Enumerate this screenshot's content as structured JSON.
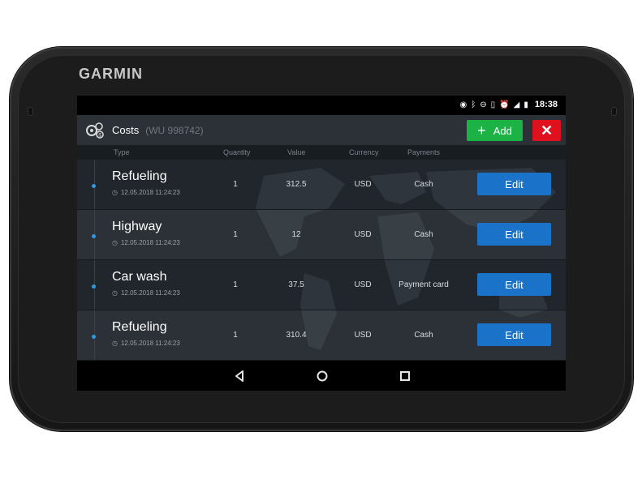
{
  "device": {
    "brand": "GARMIN"
  },
  "status_bar": {
    "time": "18:38"
  },
  "header": {
    "title": "Costs",
    "subtitle": "(WU 998742)",
    "add_label": "Add",
    "close_symbol": "✕",
    "colors": {
      "add": "#1db245",
      "close": "#e0111f"
    }
  },
  "table": {
    "columns": [
      "Type",
      "Quantity",
      "Value",
      "Currency",
      "Payments"
    ],
    "rows": [
      {
        "type": "Refueling",
        "date": "12.05.2018 11:24:23",
        "quantity": "1",
        "value": "312.5",
        "currency": "USD",
        "payment": "Cash",
        "action": "Edit"
      },
      {
        "type": "Highway",
        "date": "12.05.2018 11:24:23",
        "quantity": "1",
        "value": "12",
        "currency": "USD",
        "payment": "Cash",
        "action": "Edit"
      },
      {
        "type": "Car wash",
        "date": "12.05.2018 11:24:23",
        "quantity": "1",
        "value": "37.5",
        "currency": "USD",
        "payment": "Payment card",
        "action": "Edit"
      },
      {
        "type": "Refueling",
        "date": "12.05.2018 11:24:23",
        "quantity": "1",
        "value": "310.4",
        "currency": "USD",
        "payment": "Cash",
        "action": "Edit"
      }
    ],
    "edit_color": "#1a73c9"
  },
  "icons": {
    "header": "gears-coin-icon",
    "status": [
      "hotspot-icon",
      "bluetooth-icon",
      "do-not-disturb-icon",
      "vibrate-icon",
      "alarm-icon",
      "signal-icon",
      "battery-icon"
    ],
    "nav": [
      "back-icon",
      "home-icon",
      "recents-icon"
    ]
  }
}
